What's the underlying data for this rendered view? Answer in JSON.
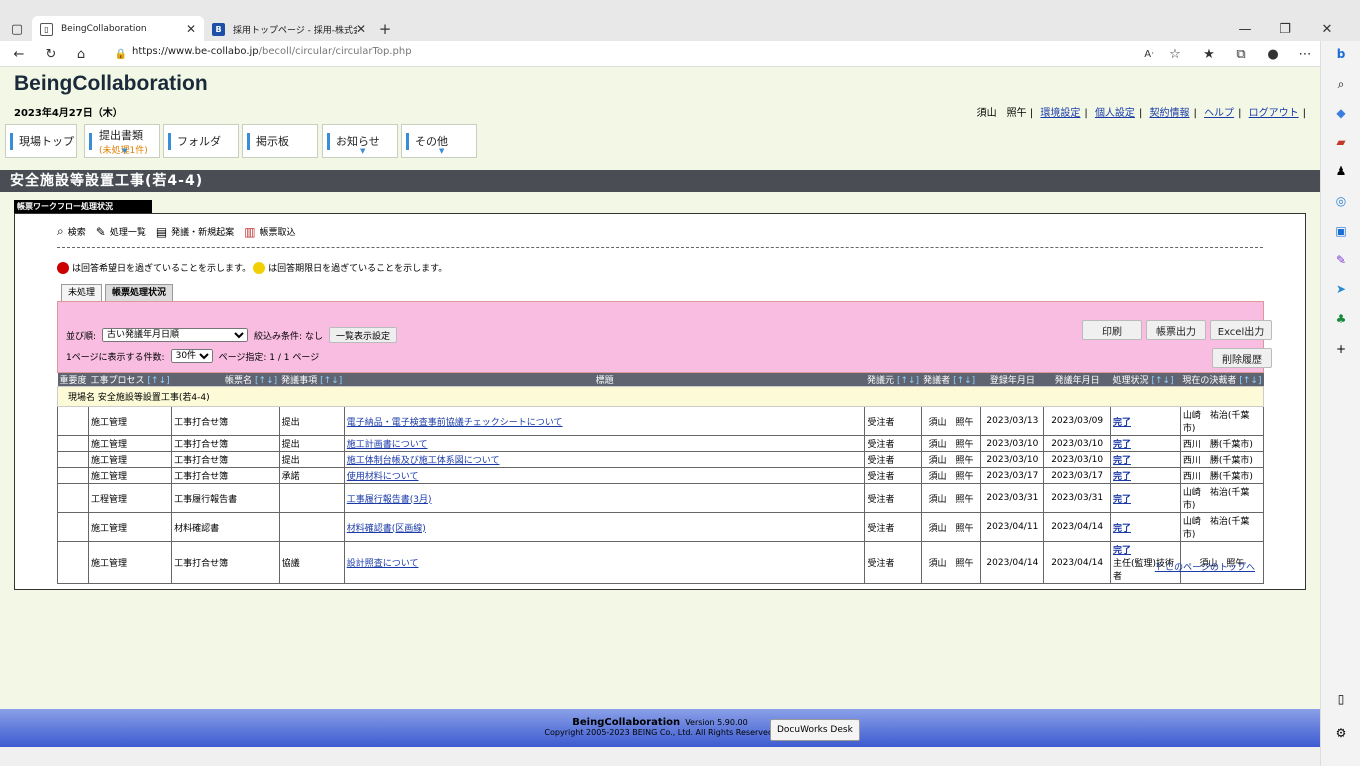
{
  "browser": {
    "tabs": [
      {
        "title": "BeingCollaboration",
        "active": true
      },
      {
        "title": "採用トップページ - 採用-株式会社ビ",
        "active": false
      }
    ],
    "url_host": "https://www.be-collabo.jp",
    "url_path": "/becoll/circular/circularTop.php"
  },
  "header": {
    "brand": "BeingCollaboration",
    "date": "2023年4月27日（木）",
    "user": "須山　照午",
    "links": [
      "環境設定",
      "個人設定",
      "契約情報",
      "ヘルプ",
      "ログアウト"
    ]
  },
  "nav": [
    {
      "label": "現場トップ"
    },
    {
      "label": "提出書類",
      "sub": "(未処理1件)"
    },
    {
      "label": "フォルダ"
    },
    {
      "label": "掲示板"
    },
    {
      "label": "お知らせ"
    },
    {
      "label": "その他"
    }
  ],
  "page_title": "安全施設等設置工事(若4-4)",
  "panel_tab": "帳票ワークフロー処理状況",
  "tools": [
    "検索",
    "処理一覧",
    "発議・新規起案",
    "帳票取込"
  ],
  "legend": {
    "red": "は回答希望日を過ぎていることを示します。",
    "yellow": "は回答期限日を過ぎていることを示します。",
    "red_color": "#cc0000",
    "yellow_color": "#f0d000"
  },
  "subtabs": [
    "未処理",
    "帳票処理状況"
  ],
  "filter": {
    "sort_label": "並び順:",
    "sort_value": "古い発議年月日順",
    "filter_label": "絞込み条件: なし",
    "list_settings": "一覧表示設定",
    "perpage_label": "1ページに表示する件数:",
    "perpage_value": "30件",
    "page_label": "ページ指定: 1 / 1 ページ"
  },
  "buttons": {
    "print": "印刷",
    "form_out": "帳票出力",
    "excel": "Excel出力",
    "history": "削除履歴"
  },
  "columns": [
    "重要度",
    "工事プロセス",
    "帳票名",
    "発議事項",
    "標題",
    "発議元",
    "発議者",
    "登録年月日",
    "発議年月日",
    "処理状況",
    "現在の決裁者"
  ],
  "site_row": "現場名 安全施設等設置工事(若4-4)",
  "rows": [
    [
      "",
      "施工管理",
      "工事打合せ簿",
      "提出",
      "電子納品・電子検査事前協議チェックシートについて",
      "受注者",
      "須山　照午",
      "2023/03/13",
      "2023/03/09",
      "完了",
      "山崎　祐治(千葉市)"
    ],
    [
      "",
      "施工管理",
      "工事打合せ簿",
      "提出",
      "施工計画書について",
      "受注者",
      "須山　照午",
      "2023/03/10",
      "2023/03/10",
      "完了",
      "西川　勝(千葉市)"
    ],
    [
      "",
      "施工管理",
      "工事打合せ簿",
      "提出",
      "施工体制台帳及び施工体系図について",
      "受注者",
      "須山　照午",
      "2023/03/10",
      "2023/03/10",
      "完了",
      "西川　勝(千葉市)"
    ],
    [
      "",
      "施工管理",
      "工事打合せ簿",
      "承諾",
      "使用材料について",
      "受注者",
      "須山　照午",
      "2023/03/17",
      "2023/03/17",
      "完了",
      "西川　勝(千葉市)"
    ],
    [
      "",
      "工程管理",
      "工事履行報告書",
      "",
      "工事履行報告書(3月)",
      "受注者",
      "須山　照午",
      "2023/03/31",
      "2023/03/31",
      "完了",
      "山崎　祐治(千葉市)"
    ],
    [
      "",
      "施工管理",
      "材料確認書",
      "",
      "材料確認書(区画線)",
      "受注者",
      "須山　照午",
      "2023/04/11",
      "2023/04/14",
      "完了",
      "山崎　祐治(千葉市)"
    ],
    [
      "",
      "施工管理",
      "工事打合せ簿",
      "協議",
      "設計照査について",
      "受注者",
      "須山　照午",
      "2023/04/14",
      "2023/04/14",
      "完了",
      "主任(監理)技術者",
      "須山　照午"
    ]
  ],
  "top_link": "↑ このページのトップへ",
  "footer": {
    "brand": "BeingCollaboration",
    "version": "Version 5.90.00",
    "copyright": "Copyright 2005-2023 BEING Co., Ltd. All Rights Reserved.",
    "docuworks": "DocuWorks Desk"
  }
}
